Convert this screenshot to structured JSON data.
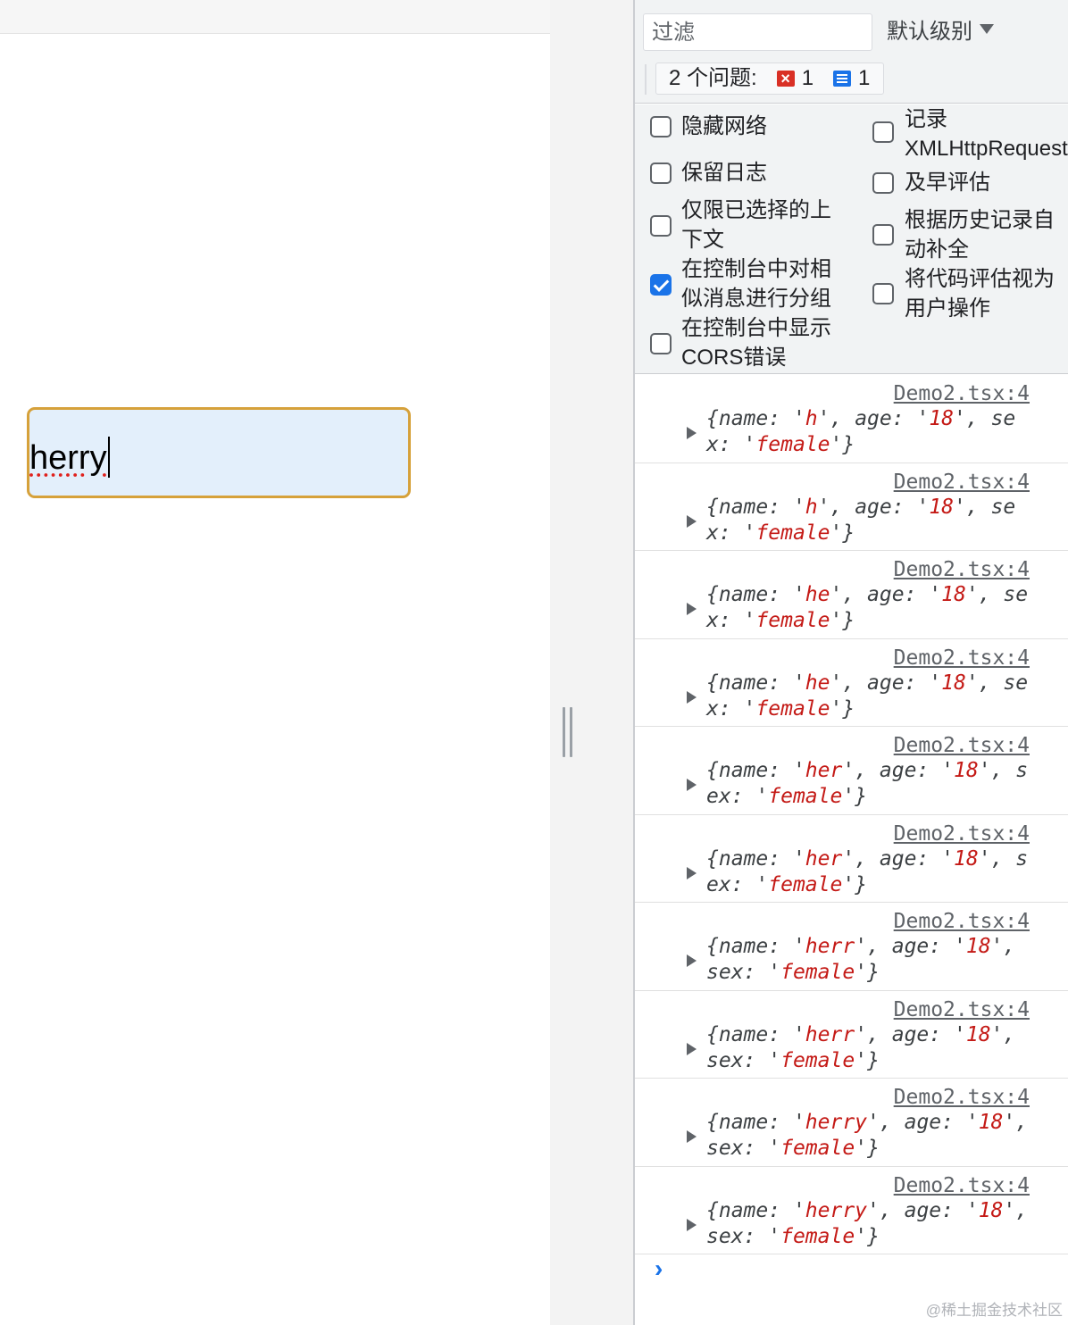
{
  "page": {
    "input_value": "herry"
  },
  "console": {
    "filter_placeholder": "过滤",
    "level_label": "默认级别",
    "issues": {
      "label": "2 个问题:",
      "error_count": "1",
      "info_count": "1"
    },
    "settings": [
      {
        "label_lines": [
          "隐藏网络"
        ],
        "checked": false
      },
      {
        "label_lines": [
          "保留日志"
        ],
        "checked": false
      },
      {
        "label_lines": [
          "仅限已选择的上",
          "下文"
        ],
        "checked": false
      },
      {
        "label_lines": [
          "在控制台中对相",
          "似消息进行分组"
        ],
        "checked": true
      },
      {
        "label_lines": [
          "在控制台中显示",
          "CORS错误"
        ],
        "checked": false
      },
      {
        "label_lines": [
          "记录",
          "XMLHttpRequest"
        ],
        "checked": false
      },
      {
        "label_lines": [
          "及早评估"
        ],
        "checked": false
      },
      {
        "label_lines": [
          "根据历史记录自",
          "动补全"
        ],
        "checked": false
      },
      {
        "label_lines": [
          "将代码评估视为",
          "用户操作"
        ],
        "checked": false
      }
    ],
    "logs": [
      {
        "source": "Demo2.tsx:4",
        "name": "h",
        "age": "18",
        "sex": "female"
      },
      {
        "source": "Demo2.tsx:4",
        "name": "h",
        "age": "18",
        "sex": "female"
      },
      {
        "source": "Demo2.tsx:4",
        "name": "he",
        "age": "18",
        "sex": "female"
      },
      {
        "source": "Demo2.tsx:4",
        "name": "he",
        "age": "18",
        "sex": "female"
      },
      {
        "source": "Demo2.tsx:4",
        "name": "her",
        "age": "18",
        "sex": "female"
      },
      {
        "source": "Demo2.tsx:4",
        "name": "her",
        "age": "18",
        "sex": "female"
      },
      {
        "source": "Demo2.tsx:4",
        "name": "herr",
        "age": "18",
        "sex": "female"
      },
      {
        "source": "Demo2.tsx:4",
        "name": "herr",
        "age": "18",
        "sex": "female"
      },
      {
        "source": "Demo2.tsx:4",
        "name": "herry",
        "age": "18",
        "sex": "female"
      },
      {
        "source": "Demo2.tsx:4",
        "name": "herry",
        "age": "18",
        "sex": "female"
      }
    ],
    "prompt_symbol": "›"
  },
  "watermark": "@稀土掘金技术社区",
  "colors": {
    "input_border": "#d6a13a",
    "input_bg": "#e3effb",
    "string_value": "#c41a16",
    "checkbox_checked": "#1a73e8",
    "error_icon": "#d93025",
    "info_icon": "#1a73e8"
  }
}
